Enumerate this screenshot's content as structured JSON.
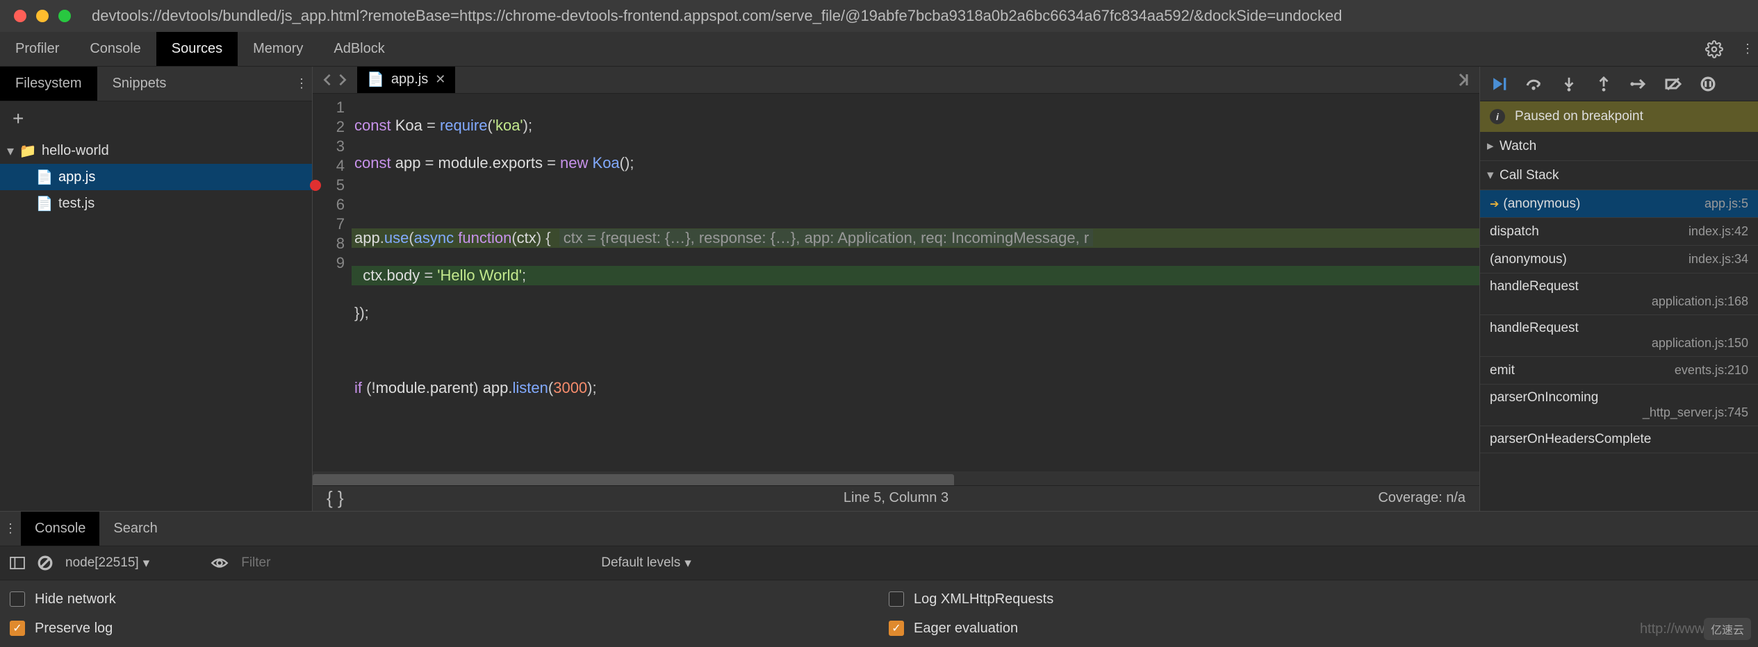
{
  "window": {
    "url": "devtools://devtools/bundled/js_app.html?remoteBase=https://chrome-devtools-frontend.appspot.com/serve_file/@19abfe7bcba9318a0b2a6bc6634a67fc834aa592/&dockSide=undocked"
  },
  "top_tabs": [
    "Profiler",
    "Console",
    "Sources",
    "Memory",
    "AdBlock"
  ],
  "top_tab_active": "Sources",
  "sidebar": {
    "tabs": [
      "Filesystem",
      "Snippets"
    ],
    "active": "Filesystem",
    "tree": {
      "folder": "hello-world",
      "files": [
        "app.js",
        "test.js"
      ],
      "selected": "app.js"
    }
  },
  "editor": {
    "tab": {
      "name": "app.js"
    },
    "breakpoint_line": 5,
    "lines": [
      "const Koa = require('koa');",
      "const app = module.exports = new Koa();",
      "",
      "app.use(async function(ctx) {  ctx = {request: {…}, response: {…}, app: Application, req: IncomingMessage, r",
      "  ctx.body = 'Hello World';",
      "});",
      "",
      "if (!module.parent) app.listen(3000);",
      ""
    ],
    "status": {
      "cursor": "Line 5, Column 3",
      "coverage": "Coverage: n/a"
    }
  },
  "debugger": {
    "paused_msg": "Paused on breakpoint",
    "sections": {
      "watch": "Watch",
      "call_stack": "Call Stack"
    },
    "frames": [
      {
        "name": "(anonymous)",
        "loc": "app.js:5",
        "current": true
      },
      {
        "name": "dispatch",
        "loc": "index.js:42"
      },
      {
        "name": "(anonymous)",
        "loc": "index.js:34"
      },
      {
        "name": "handleRequest",
        "loc": "application.js:168"
      },
      {
        "name": "handleRequest",
        "loc": "application.js:150"
      },
      {
        "name": "emit",
        "loc": "events.js:210"
      },
      {
        "name": "parserOnIncoming",
        "loc": "_http_server.js:745"
      },
      {
        "name": "parserOnHeadersComplete",
        "loc": ""
      }
    ]
  },
  "drawer": {
    "tabs": [
      "Console",
      "Search"
    ],
    "active": "Console",
    "context": "node[22515]",
    "filter_placeholder": "Filter",
    "levels": "Default levels",
    "options": {
      "hide_network": {
        "label": "Hide network",
        "checked": false
      },
      "preserve_log": {
        "label": "Preserve log",
        "checked": true
      },
      "log_xhr": {
        "label": "Log XMLHttpRequests",
        "checked": false
      },
      "eager_eval": {
        "label": "Eager evaluation",
        "checked": true
      }
    },
    "watermark": "http://www.flyde",
    "corner": "亿速云"
  }
}
